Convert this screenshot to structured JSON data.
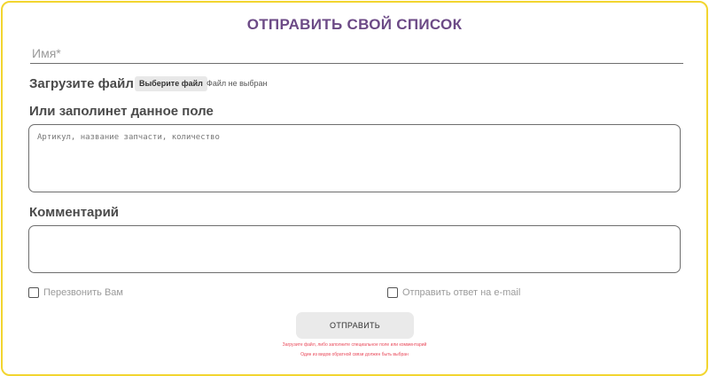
{
  "form": {
    "title": "ОТПРАВИТЬ СВОЙ СПИСОК",
    "name_placeholder": "Имя*",
    "upload_label": "Загрузите файл",
    "choose_file_label": "Выберите файл",
    "file_status": "Файл не выбран",
    "fill_label": "Или заполинет данное поле",
    "parts_placeholder": "Артикул, название запчасти, количество",
    "comment_label": "Комментарий",
    "comment_value": "",
    "callback_label": "Перезвонить Вам",
    "email_label": "Отправить ответ на e-mail",
    "submit_label": "ОТПРАВИТЬ",
    "error_1": "Загрузите файл, либо заполните специальное поле или комментарий",
    "error_2": "Один из видов обратной связи должен быть выбран"
  },
  "colors": {
    "frame_border": "#f2d52f",
    "title": "#6c4a86",
    "error": "#e9495a"
  }
}
